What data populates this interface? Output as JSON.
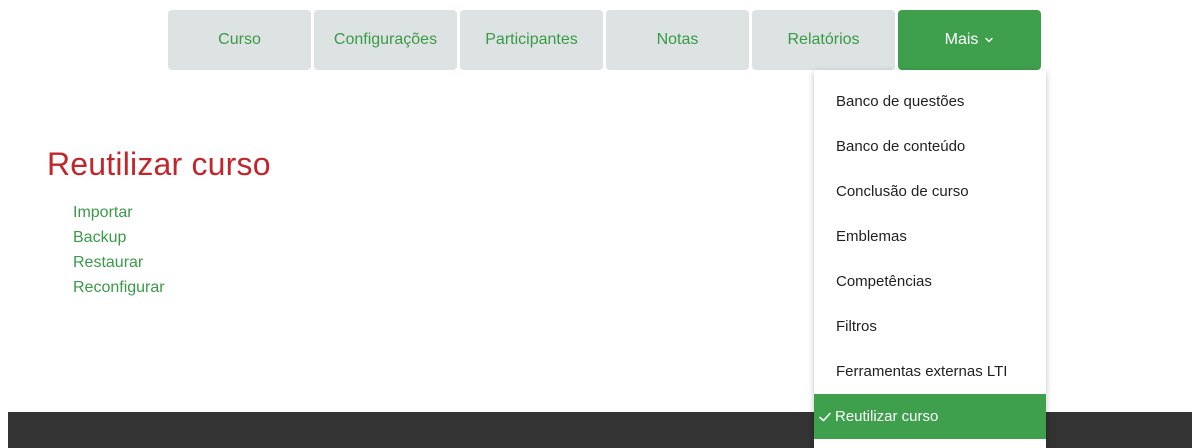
{
  "nav": {
    "tabs": [
      {
        "label": "Curso"
      },
      {
        "label": "Configurações"
      },
      {
        "label": "Participantes"
      },
      {
        "label": "Notas"
      },
      {
        "label": "Relatórios"
      },
      {
        "label": "Mais"
      }
    ],
    "active_tab": "Mais",
    "more_icon": "chevron-down-icon"
  },
  "main": {
    "title": "Reutilizar curso",
    "links": [
      "Importar",
      "Backup",
      "Restaurar",
      "Reconfigurar"
    ]
  },
  "menu": {
    "items": [
      "Banco de questões",
      "Banco de conteúdo",
      "Conclusão de curso",
      "Emblemas",
      "Competências",
      "Filtros",
      "Ferramentas externas LTI",
      "Reutilizar curso"
    ],
    "selected": "Reutilizar curso",
    "selected_icon": "checkmark-icon"
  },
  "colors": {
    "accent": "#3ea04d",
    "link": "#3a9a47",
    "title": "#c1262b",
    "tab_bg": "#dce3e2",
    "footer": "#333333"
  }
}
